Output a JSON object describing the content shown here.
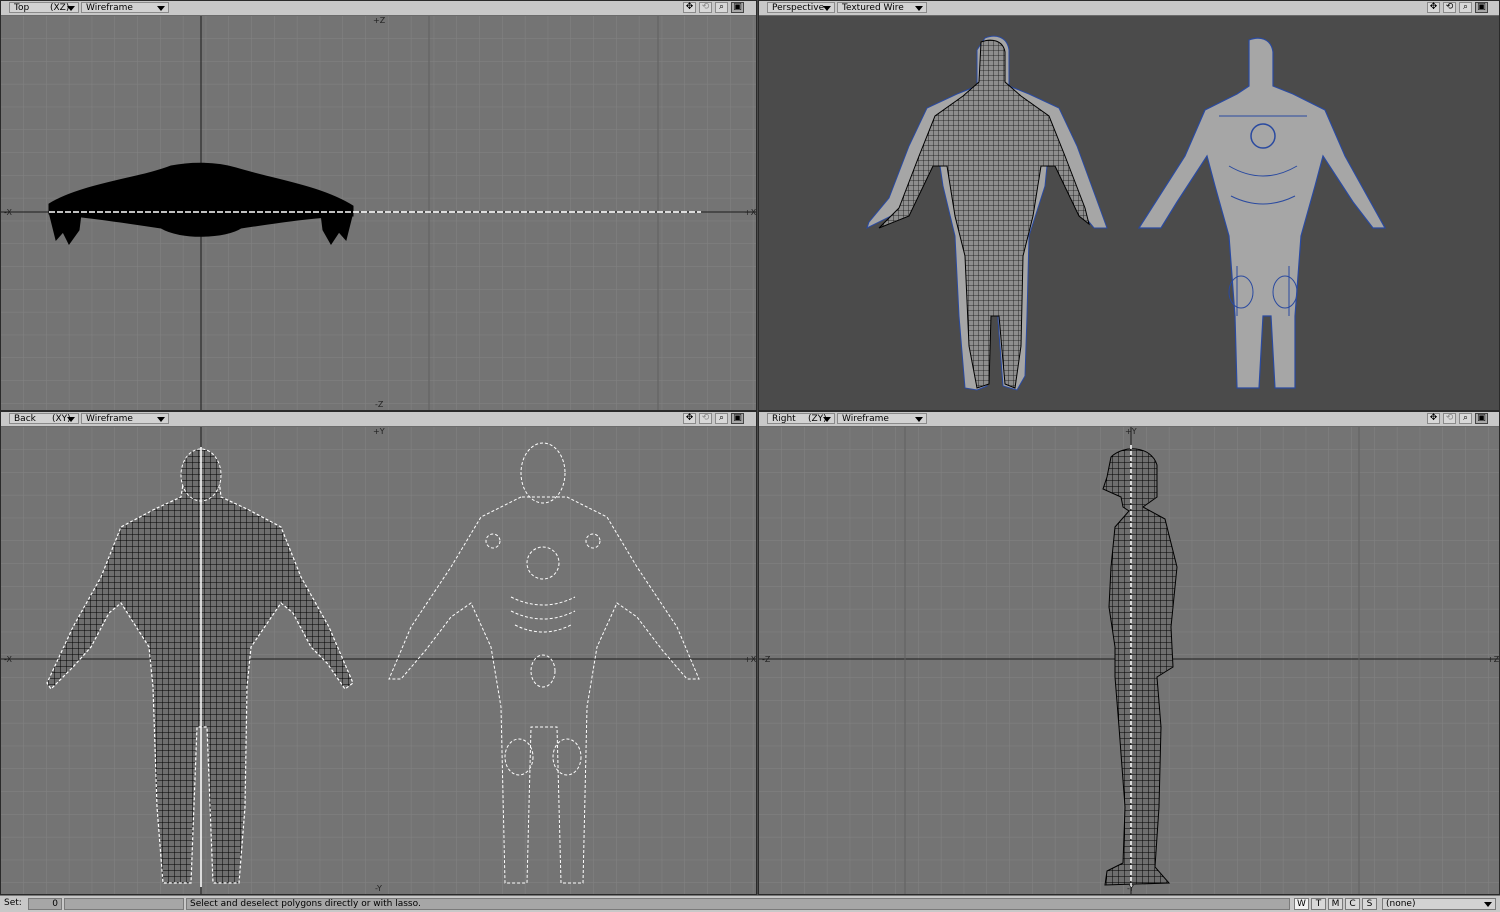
{
  "viewports": {
    "top": {
      "view": "Top",
      "axes": "(XZ)",
      "mode": "Wireframe",
      "labels": {
        "n": "+Z",
        "s": "-Z",
        "e": "+X",
        "w": "-X"
      }
    },
    "perspective": {
      "view": "Perspective",
      "mode": "Textured Wire"
    },
    "back": {
      "view": "Back",
      "axes": "(XY)",
      "mode": "Wireframe",
      "labels": {
        "n": "+Y",
        "s": "-Y",
        "e": "+X",
        "w": "-X"
      }
    },
    "right": {
      "view": "Right",
      "axes": "(ZY)",
      "mode": "Wireframe",
      "labels": {
        "n": "+Y",
        "s": "-Y",
        "e": "+Z",
        "w": "-Z"
      }
    }
  },
  "icons": [
    "move-icon",
    "rotate-icon",
    "zoom-icon",
    "maximize-icon"
  ],
  "status": {
    "set_label": "Set:",
    "set_value": "0",
    "message": "Select and deselect polygons directly or with lasso.",
    "mode_buttons": [
      "W",
      "T",
      "M",
      "C",
      "S"
    ],
    "layer": "(none)"
  },
  "colors": {
    "viewport_bg": "#747474",
    "perspective_bg": "#4b4b4b",
    "mesh": "#000000",
    "template_line": "#ffffff",
    "template_fill": "#a6a6a6",
    "panel_line": "#2a4aa0"
  }
}
